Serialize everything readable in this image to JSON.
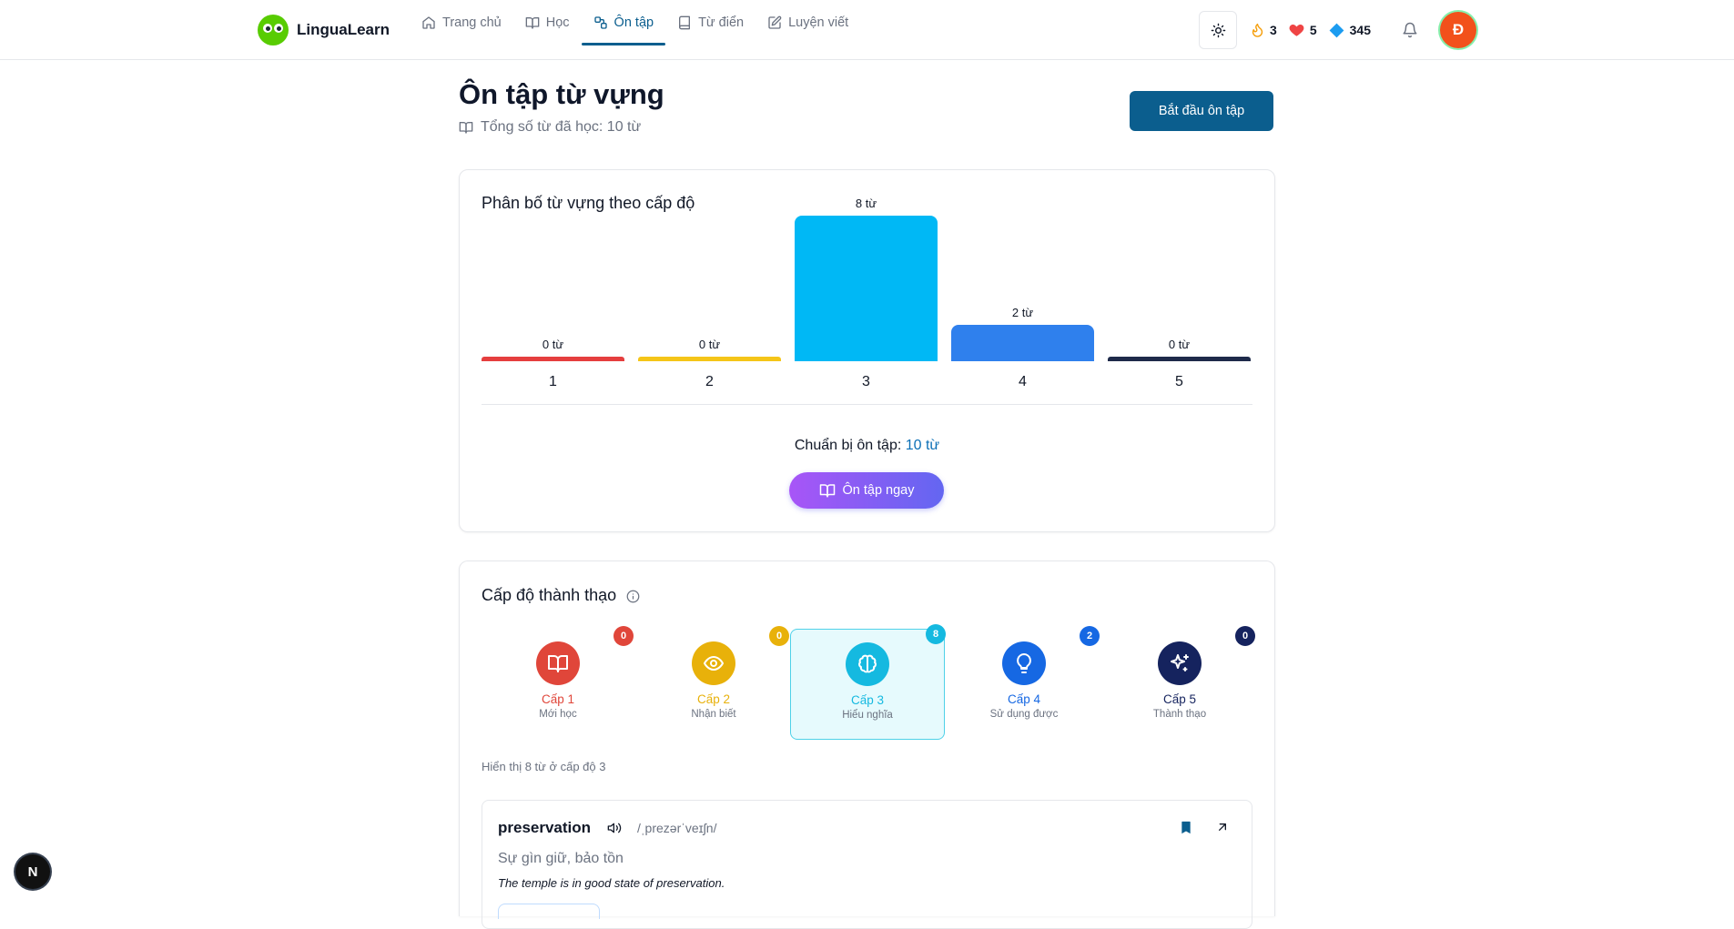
{
  "app": {
    "name": "LinguaLearn"
  },
  "nav": {
    "items": [
      {
        "label": "Trang chủ",
        "icon": "home-icon"
      },
      {
        "label": "Học",
        "icon": "book-open-icon"
      },
      {
        "label": "Ôn tập",
        "icon": "review-icon",
        "active": true
      },
      {
        "label": "Từ điển",
        "icon": "book-icon"
      },
      {
        "label": "Luyện viết",
        "icon": "pen-square-icon"
      }
    ]
  },
  "stats": {
    "streak": "3",
    "hearts": "5",
    "gems": "345"
  },
  "user": {
    "initial": "Đ"
  },
  "header": {
    "title": "Ôn tập từ vựng",
    "subtitle": "Tổng số từ đã học: 10 từ",
    "start_button": "Bắt đầu ôn tập"
  },
  "distribution": {
    "title": "Phân bố từ vựng theo cấp độ",
    "prepare_label": "Chuẩn bị ôn tập:",
    "prepare_value": "10 từ",
    "review_button": "Ôn tập ngay"
  },
  "chart_data": {
    "type": "bar",
    "title": "Phân bố từ vựng theo cấp độ",
    "categories": [
      "1",
      "2",
      "3",
      "4",
      "5"
    ],
    "values": [
      0,
      0,
      8,
      2,
      0
    ],
    "value_labels": [
      "0 từ",
      "0 từ",
      "8 từ",
      "2 từ",
      "0 từ"
    ],
    "colors": [
      "#e53e3e",
      "#f5c518",
      "#00b8f5",
      "#2f80ed",
      "#1e2a4a"
    ],
    "grid": false,
    "legend": "none"
  },
  "proficiency": {
    "title": "Cấp độ thành thạo",
    "levels": [
      {
        "name": "Cấp 1",
        "desc": "Mới học",
        "count": "0",
        "color": "#e0463a",
        "icon": "book-open-icon"
      },
      {
        "name": "Cấp 2",
        "desc": "Nhận biết",
        "count": "0",
        "color": "#e8b10a",
        "icon": "eye-icon"
      },
      {
        "name": "Cấp 3",
        "desc": "Hiểu nghĩa",
        "count": "8",
        "color": "#15b9e0",
        "icon": "brain-icon",
        "active": true
      },
      {
        "name": "Cấp 4",
        "desc": "Sử dụng được",
        "count": "2",
        "color": "#1668e3",
        "icon": "lightbulb-icon"
      },
      {
        "name": "Cấp 5",
        "desc": "Thành thạo",
        "count": "0",
        "color": "#15235e",
        "icon": "sparkles-icon"
      }
    ],
    "showing": "Hiển thị 8 từ ở cấp độ 3"
  },
  "word": {
    "term": "preservation",
    "ipa": "/ˌprezərˈveɪʃn/",
    "meaning": "Sự gìn giữ, bảo tồn",
    "example": "The temple is in good state of preservation."
  },
  "devtools": {
    "label": "N"
  }
}
